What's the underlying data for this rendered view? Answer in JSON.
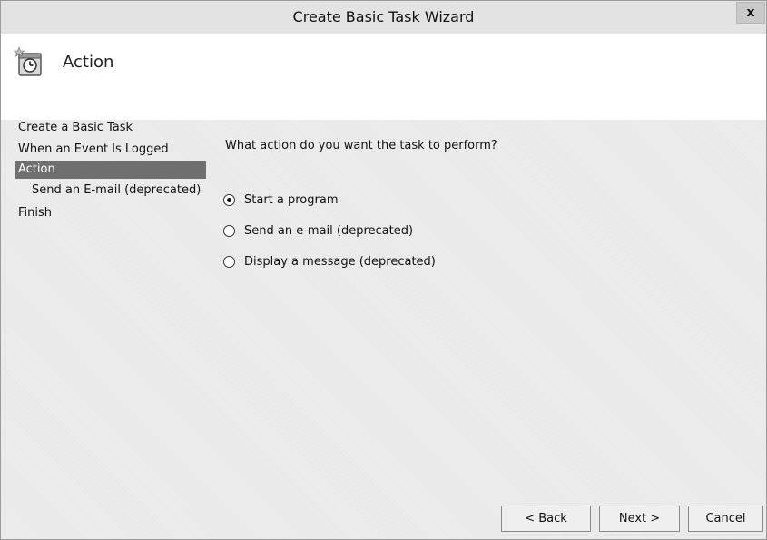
{
  "window": {
    "title": "Create Basic Task Wizard",
    "close_glyph": "x"
  },
  "header": {
    "title": "Action",
    "icon": "task-scheduler-icon"
  },
  "nav": {
    "items": [
      {
        "label": "Create a Basic Task"
      },
      {
        "label": "When an Event Is Logged"
      },
      {
        "label": "Action"
      },
      {
        "label": "Send an E-mail (deprecated)"
      },
      {
        "label": "Finish"
      }
    ],
    "active_index": 2
  },
  "main": {
    "prompt": "What action do you want the task to perform?",
    "options": [
      {
        "label": "Start a program",
        "checked": true
      },
      {
        "label": "Send an e-mail (deprecated)",
        "checked": false
      },
      {
        "label": "Display a message (deprecated)",
        "checked": false
      }
    ]
  },
  "buttons": {
    "back": "< Back",
    "next": "Next >",
    "cancel": "Cancel"
  },
  "colors": {
    "selected_nav": "#6f6f6f",
    "titlebar": "#e3e3e3"
  }
}
